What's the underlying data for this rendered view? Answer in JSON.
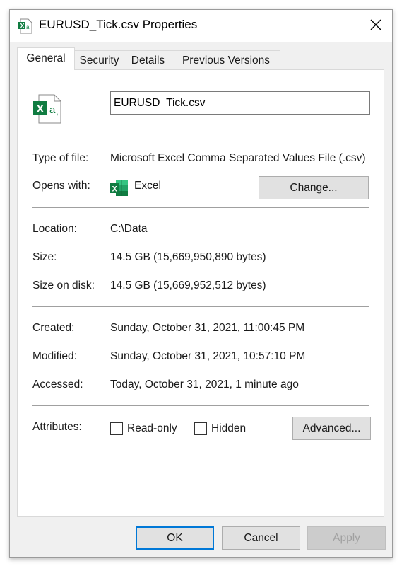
{
  "window": {
    "title": "EURUSD_Tick.csv Properties"
  },
  "tabs": [
    {
      "label": "General"
    },
    {
      "label": "Security"
    },
    {
      "label": "Details"
    },
    {
      "label": "Previous Versions"
    }
  ],
  "general": {
    "file_name": "EURUSD_Tick.csv",
    "type_label": "Type of file:",
    "type_value": "Microsoft Excel Comma Separated Values File (.csv)",
    "opens_label": "Opens with:",
    "opens_value": "Excel",
    "change_button": "Change...",
    "location_label": "Location:",
    "location_value": "C:\\Data",
    "size_label": "Size:",
    "size_value": "14.5 GB (15,669,950,890 bytes)",
    "size_disk_label": "Size on disk:",
    "size_disk_value": "14.5 GB (15,669,952,512 bytes)",
    "created_label": "Created:",
    "created_value": "Sunday, October 31, 2021, 11:00:45 PM",
    "modified_label": "Modified:",
    "modified_value": "Sunday, October 31, 2021, 10:57:10 PM",
    "accessed_label": "Accessed:",
    "accessed_value": "Today, October 31, 2021, 1 minute ago",
    "attributes_label": "Attributes:",
    "readonly_label": "Read-only",
    "hidden_label": "Hidden",
    "advanced_button": "Advanced..."
  },
  "footer": {
    "ok": "OK",
    "cancel": "Cancel",
    "apply": "Apply"
  },
  "icons": {
    "file": "excel-csv-file-icon",
    "app": "excel-app-icon",
    "close": "close-icon"
  },
  "colors": {
    "excel_green": "#107c41",
    "accent_blue": "#0078d7"
  }
}
